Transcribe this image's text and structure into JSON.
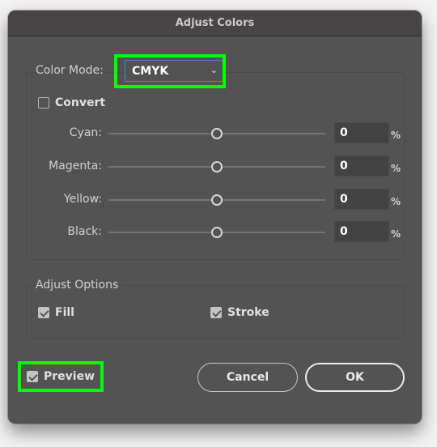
{
  "dialog": {
    "title": "Adjust Colors",
    "color_mode": {
      "label": "Color Mode:",
      "selected": "CMYK",
      "chevron_icon": "chevron-down-icon"
    },
    "convert": {
      "label": "Convert",
      "checked": false
    },
    "channels": [
      {
        "label": "Cyan:",
        "value": "0",
        "unit": "%",
        "slider_fraction": 0.5
      },
      {
        "label": "Magenta:",
        "value": "0",
        "unit": "%",
        "slider_fraction": 0.5
      },
      {
        "label": "Yellow:",
        "value": "0",
        "unit": "%",
        "slider_fraction": 0.5
      },
      {
        "label": "Black:",
        "value": "0",
        "unit": "%",
        "slider_fraction": 0.5
      }
    ],
    "adjust_options": {
      "title": "Adjust Options",
      "fill": {
        "label": "Fill",
        "checked": true
      },
      "stroke": {
        "label": "Stroke",
        "checked": true
      }
    },
    "preview": {
      "label": "Preview",
      "checked": true
    },
    "buttons": {
      "cancel": "Cancel",
      "ok": "OK"
    },
    "highlight_color": "#00ff00",
    "accent_color": "#4f83c9"
  }
}
